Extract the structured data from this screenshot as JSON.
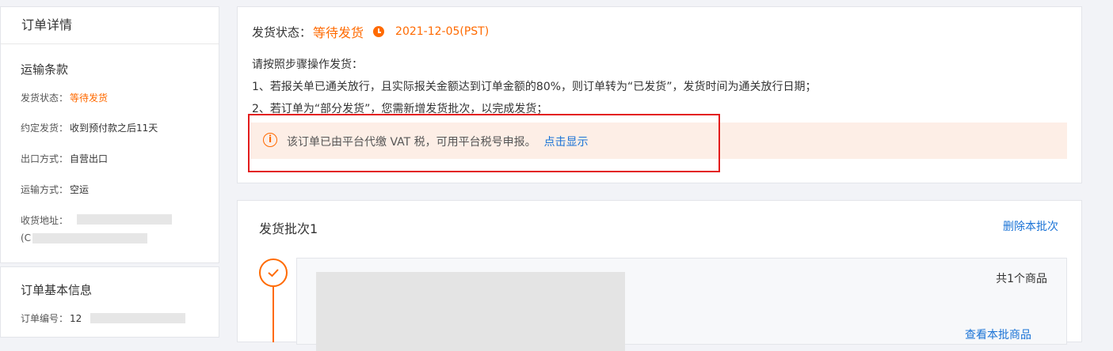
{
  "left_panel": {
    "title": "订单详情",
    "shipping_terms": {
      "title": "运输条款",
      "rows": [
        {
          "label": "发货状态：",
          "value": "等待发货"
        },
        {
          "label": "约定发货：",
          "value": "收到预付款之后11天"
        },
        {
          "label": "出口方式：",
          "value": "自营出口"
        },
        {
          "label": "运输方式：",
          "value": "空运"
        },
        {
          "label": "收货地址：",
          "value": ""
        }
      ],
      "address_prefix": "(C"
    },
    "order_info": {
      "title": "订单基本信息",
      "order_no_label": "订单编号：",
      "order_no_value": "12"
    }
  },
  "status_panel": {
    "label": "发货状态：",
    "status": "等待发货",
    "date": "2021-12-05(PST)",
    "instructions": [
      "请按照步骤操作发货：",
      "1、若报关单已通关放行，且实际报关金额达到订单金额的80%，则订单转为“已发货”，发货时间为通关放行日期；",
      "2、若订单为“部分发货”，您需新增发货批次，以完成发货；"
    ],
    "notice": {
      "icon": "i",
      "text": "该订单已由平台代缴 VAT 税，可用平台税号申报。",
      "link": "点击显示"
    }
  },
  "batch_panel": {
    "title": "发货批次1",
    "delete_label": "删除本批次",
    "item_count": "共1个商品",
    "view_link": "查看本批商品"
  },
  "colors": {
    "accent": "#ff6a00",
    "link": "#1a73d6",
    "highlight_box": "#e31c1c"
  }
}
